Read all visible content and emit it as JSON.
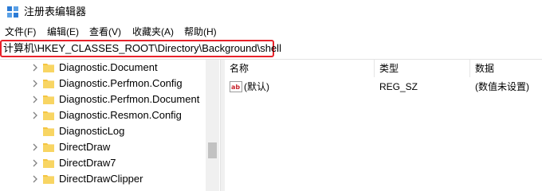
{
  "window": {
    "title": "注册表编辑器"
  },
  "menu": [
    "文件(F)",
    "编辑(E)",
    "查看(V)",
    "收藏夹(A)",
    "帮助(H)"
  ],
  "address": {
    "path": "计算机\\HKEY_CLASSES_ROOT\\Directory\\Background\\shell"
  },
  "tree": {
    "items": [
      {
        "label": "Diagnostic.Document",
        "expandable": true
      },
      {
        "label": "Diagnostic.Perfmon.Config",
        "expandable": true
      },
      {
        "label": "Diagnostic.Perfmon.Document",
        "expandable": true
      },
      {
        "label": "Diagnostic.Resmon.Config",
        "expandable": true
      },
      {
        "label": "DiagnosticLog",
        "expandable": false
      },
      {
        "label": "DirectDraw",
        "expandable": true
      },
      {
        "label": "DirectDraw7",
        "expandable": true
      },
      {
        "label": "DirectDrawClipper",
        "expandable": true
      }
    ]
  },
  "list": {
    "columns": {
      "name": "名称",
      "type": "类型",
      "data": "数据"
    },
    "rows": [
      {
        "icon": "string-value-icon",
        "name": "(默认)",
        "type": "REG_SZ",
        "data": "(数值未设置)"
      }
    ]
  },
  "colors": {
    "highlight_border": "#e8222a",
    "folder": "#f5c542"
  }
}
